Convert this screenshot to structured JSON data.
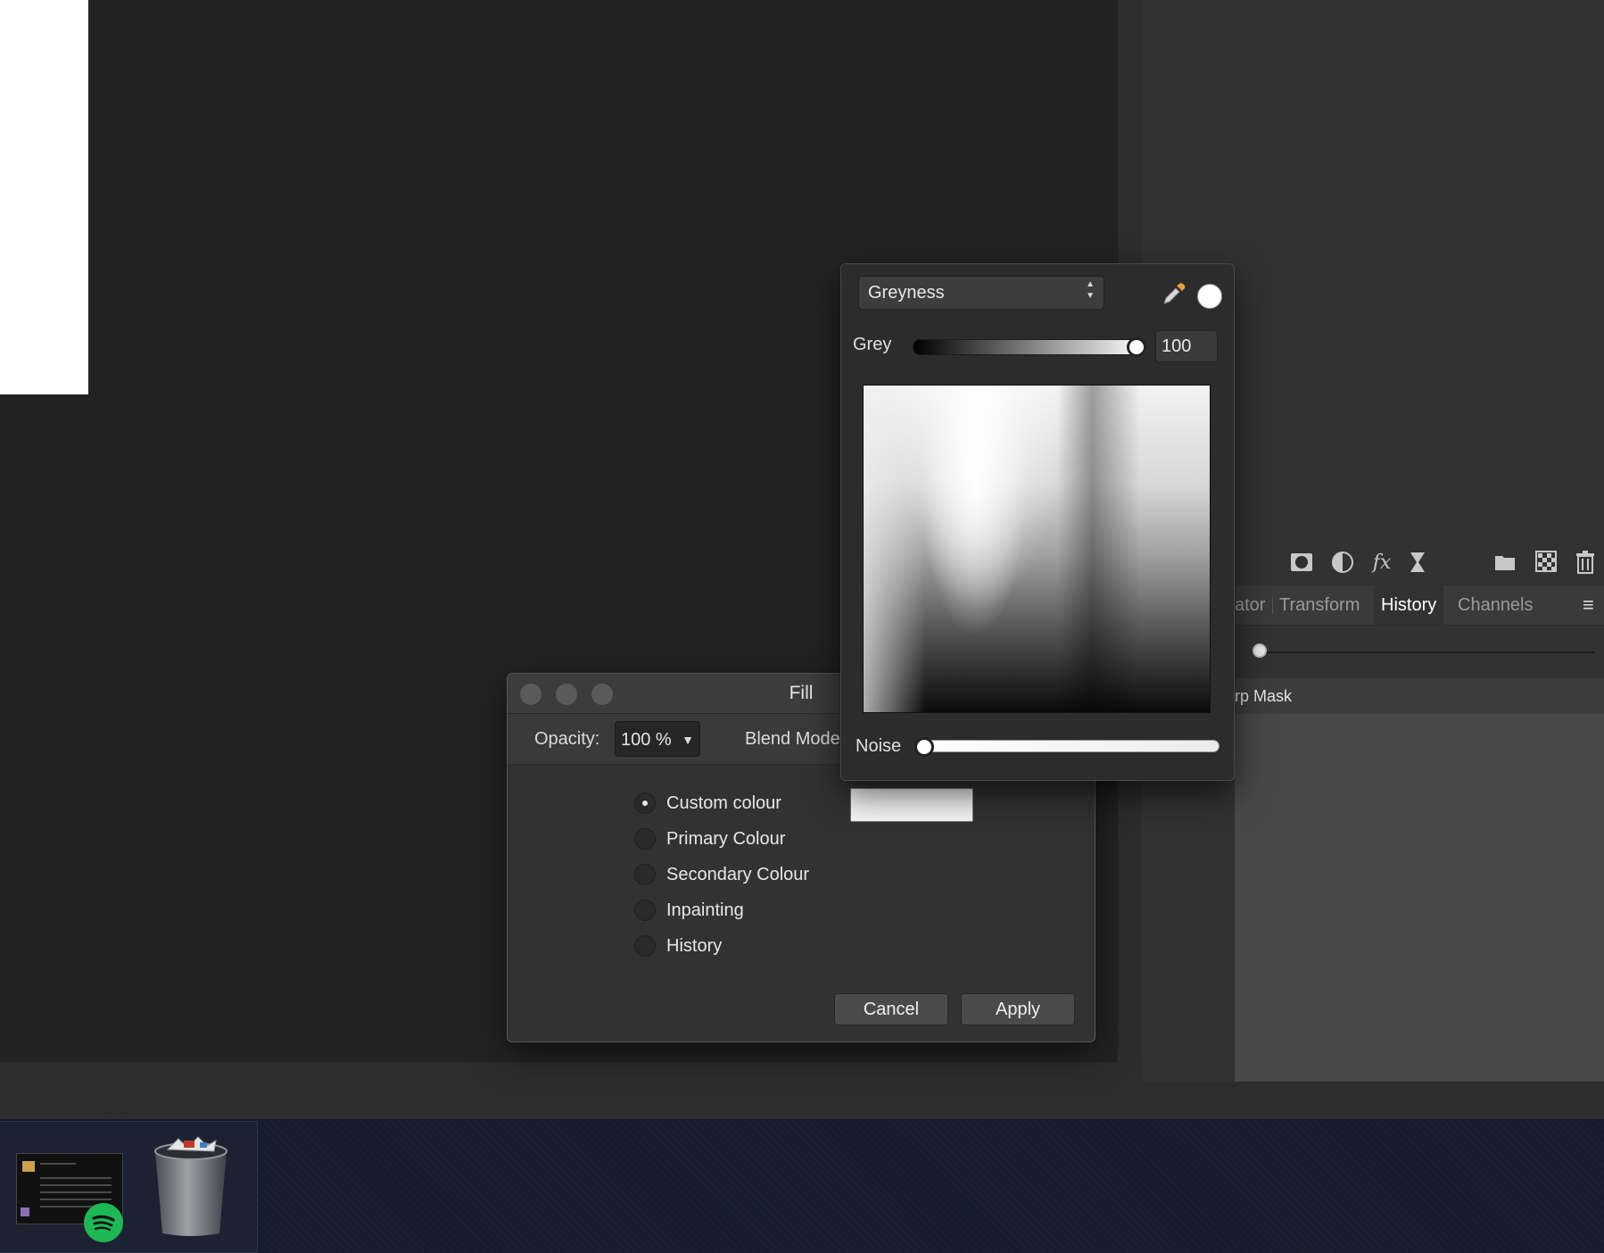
{
  "right_panel": {
    "tabs": [
      {
        "label": "ator",
        "active": false
      },
      {
        "label": "Transform",
        "active": false
      },
      {
        "label": "History",
        "active": true
      },
      {
        "label": "Channels",
        "active": false
      }
    ],
    "history_row_text": "rp Mask",
    "toolbar_icons": [
      "mask-icon",
      "adjustment-icon",
      "fx-icon",
      "hourglass-icon",
      "folder-icon",
      "checker-icon",
      "trash-icon"
    ]
  },
  "fill_dialog": {
    "title": "Fill",
    "opacity_label": "Opacity:",
    "opacity_value": "100 %",
    "blend_label": "Blend Mode",
    "options": [
      {
        "label": "Custom colour",
        "checked": true
      },
      {
        "label": "Primary Colour",
        "checked": false
      },
      {
        "label": "Secondary Colour",
        "checked": false
      },
      {
        "label": "Inpainting",
        "checked": false
      },
      {
        "label": "History",
        "checked": false
      }
    ],
    "swatch_color": "#f6f6f6",
    "cancel_label": "Cancel",
    "apply_label": "Apply"
  },
  "colour_popover": {
    "model": "Greyness",
    "grey_label": "Grey",
    "grey_value": "100",
    "noise_label": "Noise",
    "noise_value": 0,
    "current_colour": "#ffffff"
  },
  "dock": {
    "apps": [
      "Spotify",
      "Trash"
    ]
  }
}
